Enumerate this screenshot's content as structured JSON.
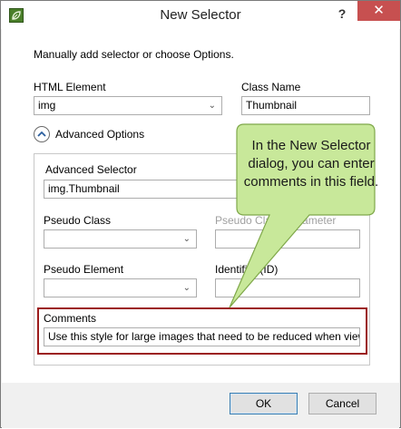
{
  "window": {
    "title": "New Selector",
    "help": "?",
    "close": "✕"
  },
  "instructions": "Manually add selector or choose Options.",
  "html_element": {
    "label": "HTML Element",
    "value": "img"
  },
  "class_name": {
    "label": "Class Name",
    "value": "Thumbnail"
  },
  "advanced": {
    "toggle_label": "Advanced Options",
    "selector_label": "Advanced Selector",
    "selector_value": "img.Thumbnail",
    "pseudo_class_label": "Pseudo Class",
    "pseudo_class_param_label": "Pseudo Class Parameter",
    "pseudo_element_label": "Pseudo Element",
    "identifier_label": "Identifier (ID)",
    "comments_label": "Comments",
    "comments_value": "Use this style for large images that need to be reduced when viewed."
  },
  "buttons": {
    "ok": "OK",
    "cancel": "Cancel"
  },
  "callout": {
    "text": "In the New Selector dialog, you can enter comments in this field."
  },
  "colors": {
    "callout_fill": "#c8e89a",
    "highlight_border": "#9b1c1c",
    "close_button": "#c75050"
  }
}
